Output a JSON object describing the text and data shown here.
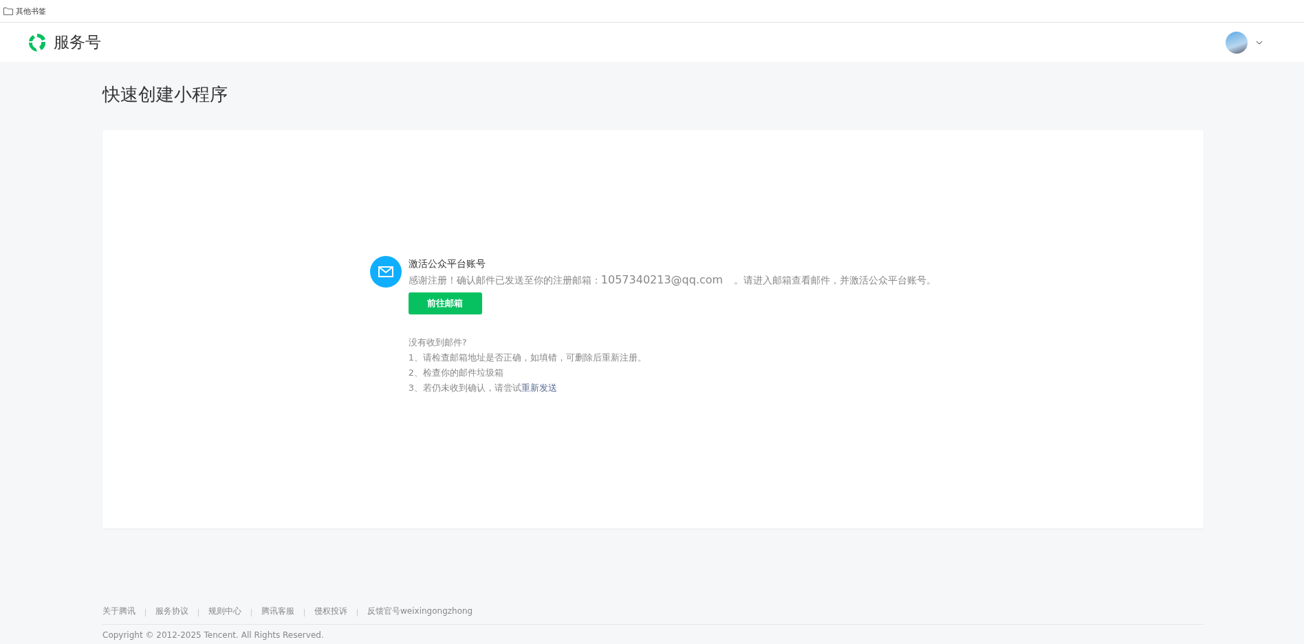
{
  "bookmarks_bar": {
    "folder": "其他书签"
  },
  "header": {
    "brand": "服务号"
  },
  "page_title": "快速创建小程序",
  "notice": {
    "title": "激活公众平台账号",
    "message_before": "感谢注册！确认邮件已发送至你的注册邮箱：",
    "email": "1057340213@qq.com",
    "message_after": "。请进入邮箱查看邮件，并激活公众平台账号。",
    "button": "前往邮箱"
  },
  "help": {
    "title": "没有收到邮件?",
    "tips": [
      "1、请检查邮箱地址是否正确，如填错，可删除后重新注册。",
      "2、检查你的邮件垃圾箱"
    ],
    "last_tip": "3、若仍未收到确认，请尝试",
    "resend_link": "重新发送"
  },
  "footer": {
    "links": [
      "关于腾讯",
      "服务协议",
      "规则中心",
      "腾讯客服",
      "侵权投诉",
      "反馈官号weixingongzhong"
    ],
    "copyright": "Copyright © 2012-2025 Tencent. All Rights Reserved."
  }
}
